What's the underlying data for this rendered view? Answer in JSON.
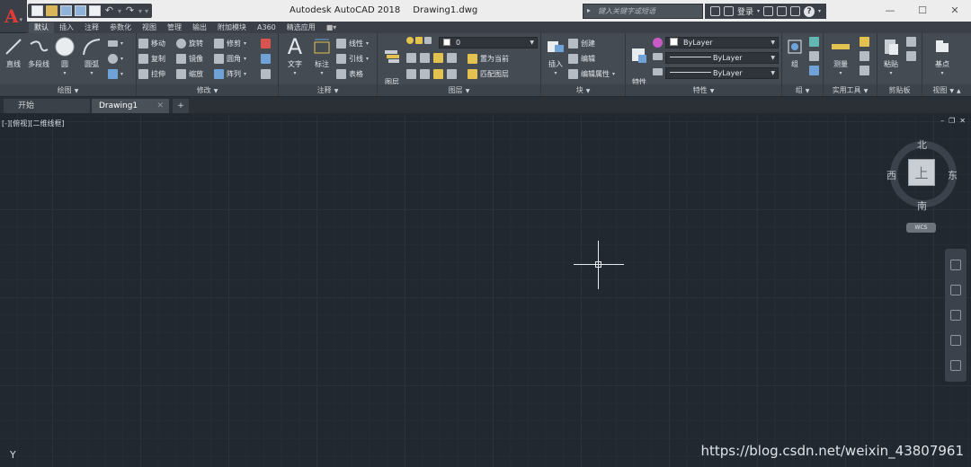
{
  "window": {
    "app_title": "Autodesk AutoCAD 2018",
    "file_name": "Drawing1.dwg",
    "search_placeholder": "键入关键字或短语",
    "login": "登录",
    "controls": {
      "minimize": "—",
      "maximize": "☐",
      "close": "✕"
    }
  },
  "app_button": {
    "letter": "A"
  },
  "ribbon_tabs": [
    "默认",
    "插入",
    "注释",
    "参数化",
    "视图",
    "管理",
    "输出",
    "附加模块",
    "A360",
    "精选应用"
  ],
  "ribbon": {
    "draw": {
      "title": "绘图",
      "big": [
        "直线",
        "多段线",
        "圆",
        "圆弧"
      ]
    },
    "modify": {
      "title": "修改",
      "tools": [
        "移动",
        "旋转",
        "修剪",
        "复制",
        "镜像",
        "圆角",
        "拉伸",
        "缩放",
        "阵列"
      ]
    },
    "annotation": {
      "title": "注释",
      "big": [
        "文字",
        "标注"
      ],
      "tools": [
        "线性",
        "引线",
        "表格"
      ]
    },
    "layers": {
      "title": "图层",
      "big_label": "图层\n特性",
      "layer_combo": "0",
      "tools": [
        "置为当前",
        "匹配图层"
      ]
    },
    "block": {
      "title": "块",
      "big": "插入",
      "tools": [
        "创建",
        "编辑",
        "编辑属性"
      ]
    },
    "properties": {
      "title": "特性",
      "big_label": "特性\n匹配",
      "color": "ByLayer",
      "linetype": "ByLayer",
      "lineweight": "ByLayer"
    },
    "groups": {
      "title": "组",
      "big": "组"
    },
    "utilities": {
      "title": "实用工具",
      "big": "测量"
    },
    "clipboard": {
      "title": "剪贴板",
      "big": "粘贴"
    },
    "view": {
      "title": "视图",
      "big": "基点"
    }
  },
  "doc_tabs": {
    "start": "开始",
    "drawing": "Drawing1",
    "add": "+"
  },
  "canvas": {
    "viewport_label": "[-][俯视][二维线框]",
    "viewcube": {
      "top": "上",
      "north": "北",
      "south": "南",
      "east": "东",
      "west": "西",
      "wcs": "WCS"
    },
    "ucs_y": "Y",
    "window_ctrl": [
      "–",
      "❐",
      "✕"
    ]
  },
  "watermark": "https://blog.csdn.net/weixin_43807961"
}
